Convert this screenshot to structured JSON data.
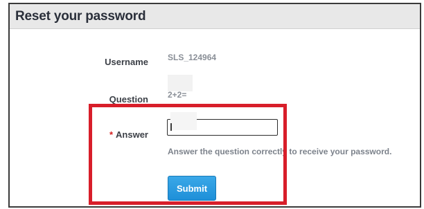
{
  "title": "Reset your password",
  "form": {
    "username_label": "Username",
    "username_value": "SLS_124964",
    "question_label": "Question",
    "question_value": "2+2=",
    "answer_required_mark": "*",
    "answer_label": "Answer",
    "answer_value": "",
    "hint_text": "Answer the question correctly to receive your password.",
    "submit_label": "Submit"
  },
  "colors": {
    "header_bg": "#e8e8e8",
    "submit_bg": "#2a9be0",
    "highlight_border": "#d81e2a",
    "required_mark": "#d62020"
  }
}
